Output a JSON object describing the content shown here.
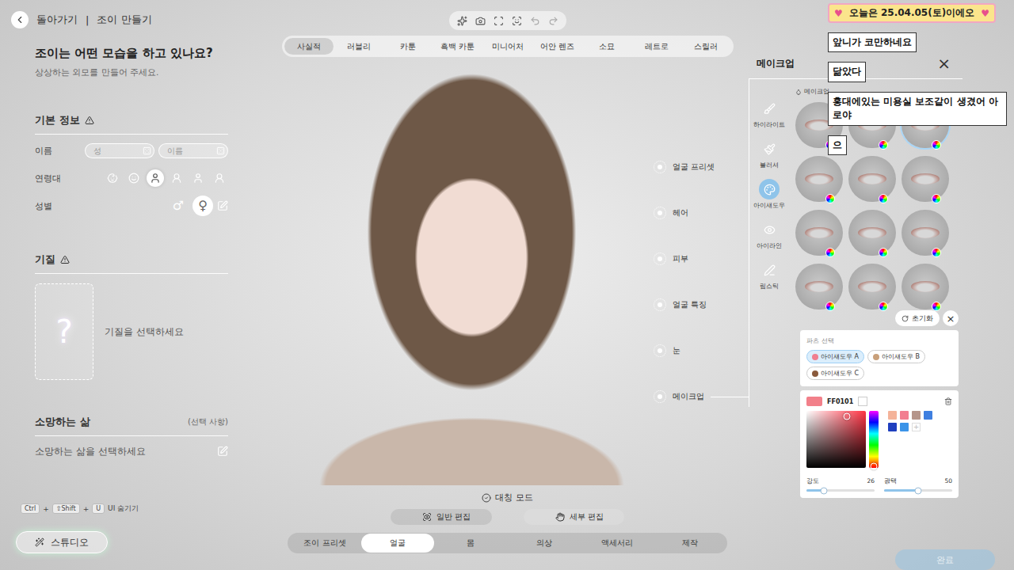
{
  "header": {
    "back_label": "돌아가기",
    "separator": "|",
    "title": "조이 만들기"
  },
  "toolbar": [
    {
      "disabled": false
    },
    {
      "disabled": false
    },
    {
      "disabled": false
    },
    {
      "disabled": false
    },
    {
      "disabled": true
    },
    {
      "disabled": true
    }
  ],
  "style_tabs": [
    {
      "label": "사실적",
      "selected": true
    },
    {
      "label": "러블리",
      "selected": false
    },
    {
      "label": "카툰",
      "selected": false
    },
    {
      "label": "흑백 카툰",
      "selected": false
    },
    {
      "label": "미니어처",
      "selected": false
    },
    {
      "label": "어안 렌즈",
      "selected": false
    },
    {
      "label": "소묘",
      "selected": false
    },
    {
      "label": "레트로",
      "selected": false
    },
    {
      "label": "스릴러",
      "selected": false
    }
  ],
  "intro": {
    "title": "조이는 어떤 모습을 하고 있나요?",
    "subtitle": "상상하는 외모를 만들어 주세요."
  },
  "basic_info": {
    "title": "기본 정보",
    "name_label": "이름",
    "name_fields": [
      {
        "placeholder": "성"
      },
      {
        "placeholder": "이름"
      }
    ],
    "age_label": "연령대",
    "ages": [
      {
        "selected": false
      },
      {
        "selected": false
      },
      {
        "selected": true
      },
      {
        "selected": false
      },
      {
        "selected": false
      },
      {
        "selected": false
      }
    ],
    "gender_label": "성별",
    "genders": [
      {
        "symbol": "♂",
        "selected": false
      },
      {
        "symbol": "♀",
        "selected": true
      }
    ]
  },
  "temperament": {
    "title": "기질",
    "card_mark": "?",
    "placeholder": "기질을 선택하세요"
  },
  "desired_life": {
    "title": "소망하는 삶",
    "optional": "(선택 사항)",
    "placeholder": "소망하는 삶을 선택하세요"
  },
  "shortcut": {
    "keys": [
      "Ctrl",
      "⇧Shift",
      "U"
    ],
    "joiner": "+",
    "label": "UI 숨기기"
  },
  "studio_button": "스튜디오",
  "categories": [
    {
      "label": "얼굴 프리셋",
      "selected": false
    },
    {
      "label": "헤어",
      "selected": false
    },
    {
      "label": "피부",
      "selected": false
    },
    {
      "label": "얼굴 특징",
      "selected": false
    },
    {
      "label": "눈",
      "selected": false
    },
    {
      "label": "메이크업",
      "selected": true
    }
  ],
  "symmetry": {
    "label": "대칭 모드",
    "checked": true
  },
  "edit_modes": [
    {
      "label": "일반 편집",
      "selected": true
    },
    {
      "label": "세부 편집",
      "selected": false
    }
  ],
  "bottom_tabs": [
    {
      "label": "조이 프리셋",
      "selected": false
    },
    {
      "label": "얼굴",
      "selected": true
    },
    {
      "label": "몸",
      "selected": false
    },
    {
      "label": "의상",
      "selected": false
    },
    {
      "label": "액세서리",
      "selected": false
    },
    {
      "label": "제작",
      "selected": false
    }
  ],
  "done_button": {
    "label": "완료",
    "disabled": true
  },
  "makeup_panel": {
    "title": "메이크업",
    "close": "×",
    "subheader": "메이크업",
    "tools": [
      {
        "label": "하이라이트",
        "selected": false
      },
      {
        "label": "블러셔",
        "selected": false
      },
      {
        "label": "아이섀도우",
        "selected": true
      },
      {
        "label": "아이라인",
        "selected": false
      },
      {
        "label": "립스틱",
        "selected": false
      }
    ],
    "presets": [
      {
        "selected": false
      },
      {
        "selected": false
      },
      {
        "selected": true
      },
      {
        "selected": false
      },
      {
        "selected": false
      },
      {
        "selected": false
      },
      {
        "selected": false
      },
      {
        "selected": false
      },
      {
        "selected": false
      },
      {
        "selected": false
      },
      {
        "selected": false
      },
      {
        "selected": false
      }
    ]
  },
  "color_editor": {
    "reset": "초기화",
    "close": "×",
    "parts_label": "파츠 선택",
    "parts": [
      {
        "label": "아이섀도우 A",
        "selected": true,
        "color": "#f07f90"
      },
      {
        "label": "아이섀도우 B",
        "selected": false,
        "color": "#c9a07a"
      },
      {
        "label": "아이섀도우 C",
        "selected": false,
        "color": "#8a5a3c"
      }
    ],
    "swatch": "#f2808a",
    "hex": "FF0101",
    "picker_point": {
      "x": 0.68,
      "y": 0.1
    },
    "hue_level": 0.97,
    "presets": [
      {
        "color": "#f4b39a"
      },
      {
        "color": "#f27e90"
      },
      {
        "color": "#b5958a"
      },
      {
        "color": "#3f7fe0"
      },
      {
        "color": "#1f3fbf"
      },
      {
        "color": "#3b94e8"
      }
    ],
    "add": "+",
    "sliders": [
      {
        "label": "강도",
        "value": "26",
        "level": 0.26
      },
      {
        "label": "광택",
        "value": "50",
        "level": 0.5
      }
    ]
  },
  "chat": {
    "banner": {
      "text": "오늘은 25.04.05(토)이에오",
      "decor": "♥"
    },
    "messages": [
      "앞니가 코만하네요",
      "닮았다",
      "홍대에있는 미용실 보조같이 생겼어 아로야",
      "으"
    ]
  }
}
